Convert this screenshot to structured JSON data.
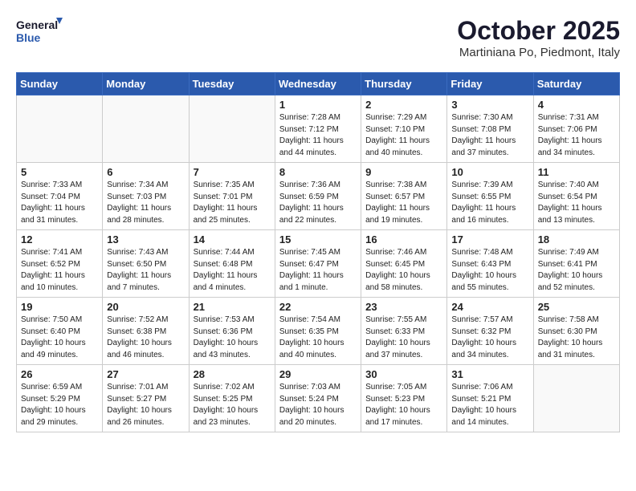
{
  "logo": {
    "general": "General",
    "blue": "Blue"
  },
  "header": {
    "month": "October 2025",
    "location": "Martiniana Po, Piedmont, Italy"
  },
  "weekdays": [
    "Sunday",
    "Monday",
    "Tuesday",
    "Wednesday",
    "Thursday",
    "Friday",
    "Saturday"
  ],
  "weeks": [
    [
      {
        "day": "",
        "info": ""
      },
      {
        "day": "",
        "info": ""
      },
      {
        "day": "",
        "info": ""
      },
      {
        "day": "1",
        "info": "Sunrise: 7:28 AM\nSunset: 7:12 PM\nDaylight: 11 hours\nand 44 minutes."
      },
      {
        "day": "2",
        "info": "Sunrise: 7:29 AM\nSunset: 7:10 PM\nDaylight: 11 hours\nand 40 minutes."
      },
      {
        "day": "3",
        "info": "Sunrise: 7:30 AM\nSunset: 7:08 PM\nDaylight: 11 hours\nand 37 minutes."
      },
      {
        "day": "4",
        "info": "Sunrise: 7:31 AM\nSunset: 7:06 PM\nDaylight: 11 hours\nand 34 minutes."
      }
    ],
    [
      {
        "day": "5",
        "info": "Sunrise: 7:33 AM\nSunset: 7:04 PM\nDaylight: 11 hours\nand 31 minutes."
      },
      {
        "day": "6",
        "info": "Sunrise: 7:34 AM\nSunset: 7:03 PM\nDaylight: 11 hours\nand 28 minutes."
      },
      {
        "day": "7",
        "info": "Sunrise: 7:35 AM\nSunset: 7:01 PM\nDaylight: 11 hours\nand 25 minutes."
      },
      {
        "day": "8",
        "info": "Sunrise: 7:36 AM\nSunset: 6:59 PM\nDaylight: 11 hours\nand 22 minutes."
      },
      {
        "day": "9",
        "info": "Sunrise: 7:38 AM\nSunset: 6:57 PM\nDaylight: 11 hours\nand 19 minutes."
      },
      {
        "day": "10",
        "info": "Sunrise: 7:39 AM\nSunset: 6:55 PM\nDaylight: 11 hours\nand 16 minutes."
      },
      {
        "day": "11",
        "info": "Sunrise: 7:40 AM\nSunset: 6:54 PM\nDaylight: 11 hours\nand 13 minutes."
      }
    ],
    [
      {
        "day": "12",
        "info": "Sunrise: 7:41 AM\nSunset: 6:52 PM\nDaylight: 11 hours\nand 10 minutes."
      },
      {
        "day": "13",
        "info": "Sunrise: 7:43 AM\nSunset: 6:50 PM\nDaylight: 11 hours\nand 7 minutes."
      },
      {
        "day": "14",
        "info": "Sunrise: 7:44 AM\nSunset: 6:48 PM\nDaylight: 11 hours\nand 4 minutes."
      },
      {
        "day": "15",
        "info": "Sunrise: 7:45 AM\nSunset: 6:47 PM\nDaylight: 11 hours\nand 1 minute."
      },
      {
        "day": "16",
        "info": "Sunrise: 7:46 AM\nSunset: 6:45 PM\nDaylight: 10 hours\nand 58 minutes."
      },
      {
        "day": "17",
        "info": "Sunrise: 7:48 AM\nSunset: 6:43 PM\nDaylight: 10 hours\nand 55 minutes."
      },
      {
        "day": "18",
        "info": "Sunrise: 7:49 AM\nSunset: 6:41 PM\nDaylight: 10 hours\nand 52 minutes."
      }
    ],
    [
      {
        "day": "19",
        "info": "Sunrise: 7:50 AM\nSunset: 6:40 PM\nDaylight: 10 hours\nand 49 minutes."
      },
      {
        "day": "20",
        "info": "Sunrise: 7:52 AM\nSunset: 6:38 PM\nDaylight: 10 hours\nand 46 minutes."
      },
      {
        "day": "21",
        "info": "Sunrise: 7:53 AM\nSunset: 6:36 PM\nDaylight: 10 hours\nand 43 minutes."
      },
      {
        "day": "22",
        "info": "Sunrise: 7:54 AM\nSunset: 6:35 PM\nDaylight: 10 hours\nand 40 minutes."
      },
      {
        "day": "23",
        "info": "Sunrise: 7:55 AM\nSunset: 6:33 PM\nDaylight: 10 hours\nand 37 minutes."
      },
      {
        "day": "24",
        "info": "Sunrise: 7:57 AM\nSunset: 6:32 PM\nDaylight: 10 hours\nand 34 minutes."
      },
      {
        "day": "25",
        "info": "Sunrise: 7:58 AM\nSunset: 6:30 PM\nDaylight: 10 hours\nand 31 minutes."
      }
    ],
    [
      {
        "day": "26",
        "info": "Sunrise: 6:59 AM\nSunset: 5:29 PM\nDaylight: 10 hours\nand 29 minutes."
      },
      {
        "day": "27",
        "info": "Sunrise: 7:01 AM\nSunset: 5:27 PM\nDaylight: 10 hours\nand 26 minutes."
      },
      {
        "day": "28",
        "info": "Sunrise: 7:02 AM\nSunset: 5:25 PM\nDaylight: 10 hours\nand 23 minutes."
      },
      {
        "day": "29",
        "info": "Sunrise: 7:03 AM\nSunset: 5:24 PM\nDaylight: 10 hours\nand 20 minutes."
      },
      {
        "day": "30",
        "info": "Sunrise: 7:05 AM\nSunset: 5:23 PM\nDaylight: 10 hours\nand 17 minutes."
      },
      {
        "day": "31",
        "info": "Sunrise: 7:06 AM\nSunset: 5:21 PM\nDaylight: 10 hours\nand 14 minutes."
      },
      {
        "day": "",
        "info": ""
      }
    ]
  ]
}
